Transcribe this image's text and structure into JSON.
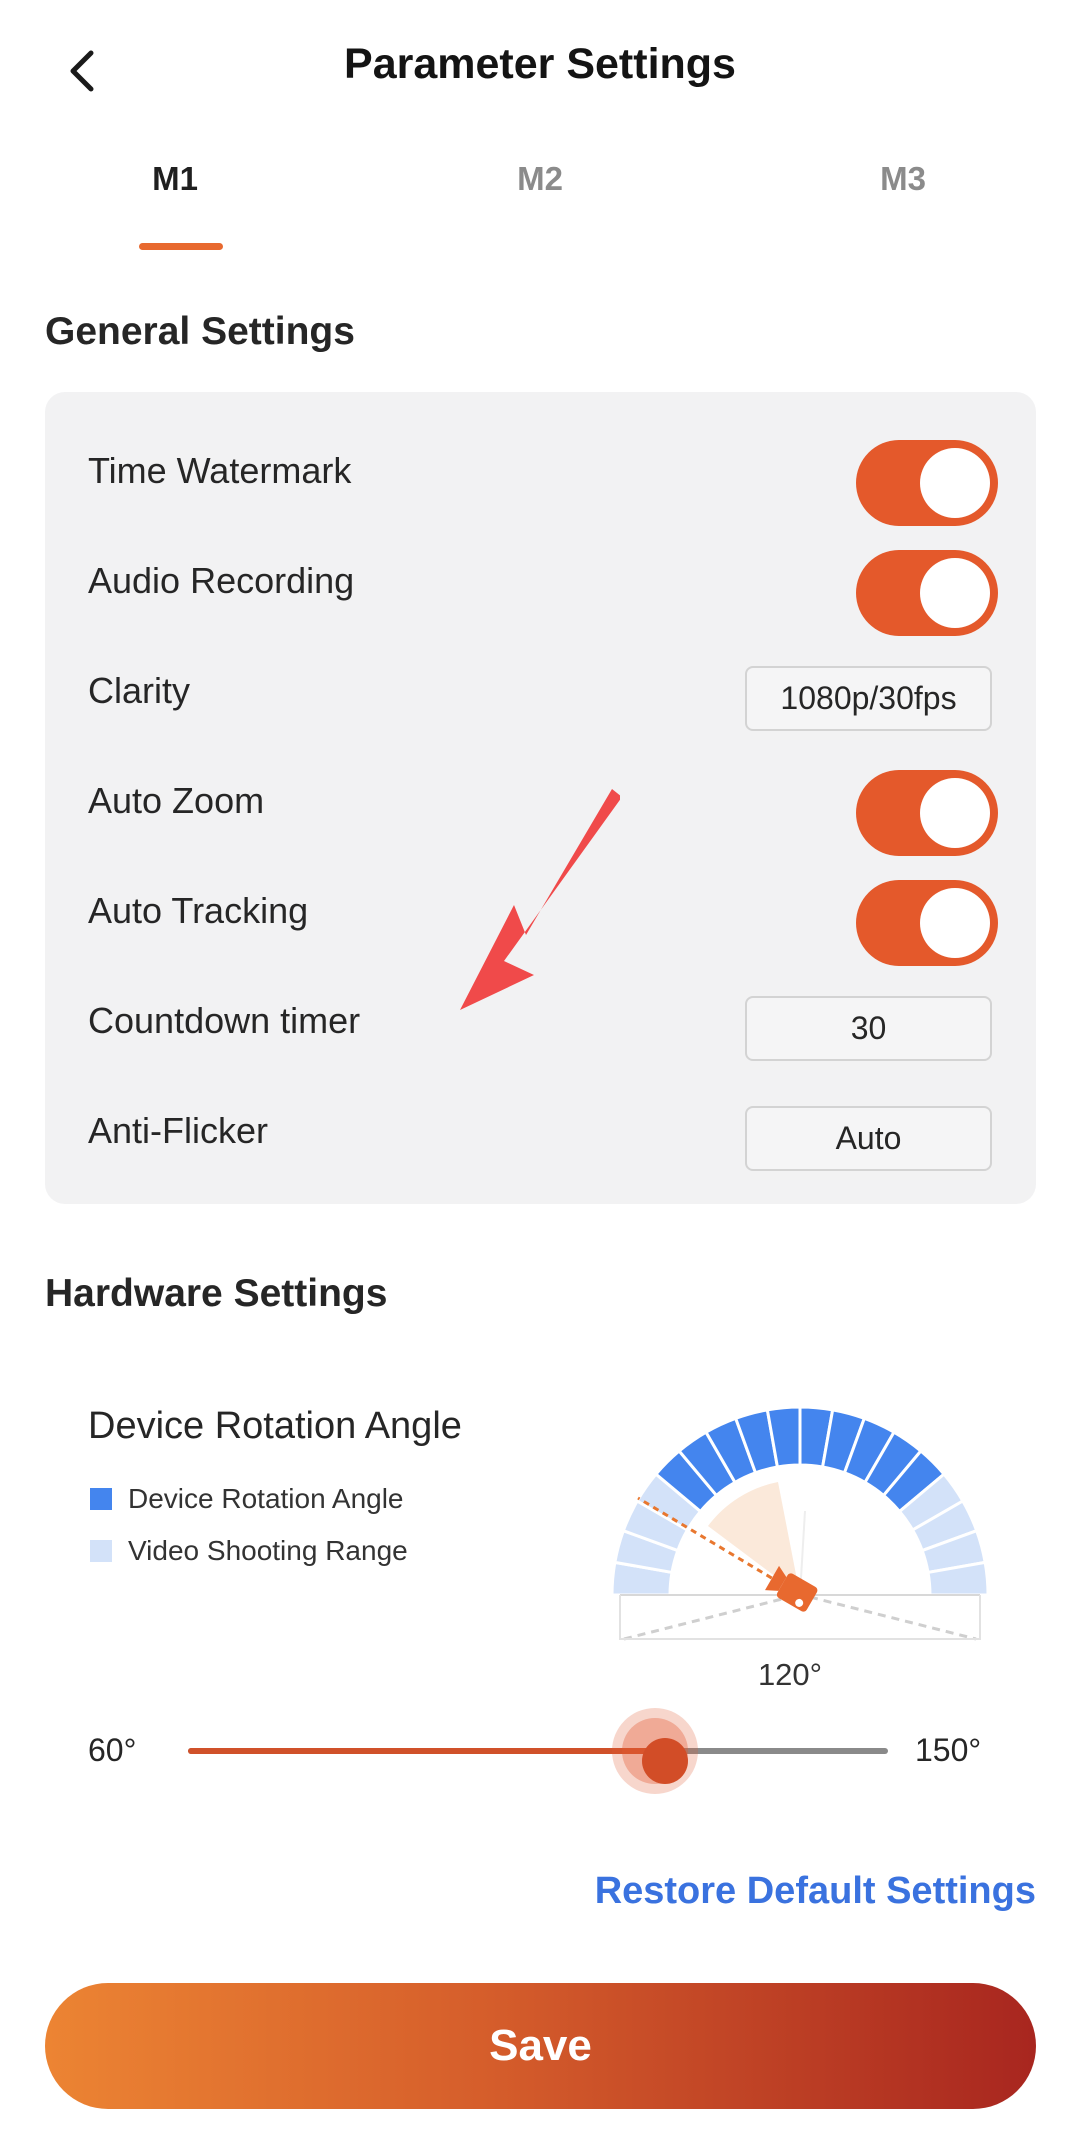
{
  "header": {
    "title": "Parameter Settings",
    "back_icon": "chevron-left-icon"
  },
  "tabs": [
    {
      "label": "M1",
      "active": true
    },
    {
      "label": "M2",
      "active": false
    },
    {
      "label": "M3",
      "active": false
    }
  ],
  "general": {
    "title": "General Settings",
    "rows": [
      {
        "label": "Time Watermark",
        "type": "toggle",
        "on": true
      },
      {
        "label": "Audio Recording",
        "type": "toggle",
        "on": true
      },
      {
        "label": "Clarity",
        "type": "select",
        "value": "1080p/30fps"
      },
      {
        "label": "Auto Zoom",
        "type": "toggle",
        "on": true
      },
      {
        "label": "Auto Tracking",
        "type": "toggle",
        "on": true
      },
      {
        "label": "Countdown timer",
        "type": "select",
        "value": "30"
      },
      {
        "label": "Anti-Flicker",
        "type": "select",
        "value": "Auto"
      }
    ]
  },
  "hardware": {
    "title": "Hardware Settings",
    "rotation_label": "Device Rotation Angle",
    "legend": [
      {
        "label": "Device Rotation Angle",
        "color": "#4485ee"
      },
      {
        "label": "Video Shooting Range",
        "color": "#d3e2f9"
      }
    ],
    "angle_display": "120°",
    "slider": {
      "min_label": "60°",
      "max_label": "150°",
      "min": 60,
      "max": 150,
      "value": 120
    }
  },
  "restore_label": "Restore Default Settings",
  "save_label": "Save",
  "colors": {
    "accent": "#e4592b",
    "link": "#3a72df",
    "rotation_blue": "#4485ee",
    "range_light": "#d3e2f9"
  }
}
